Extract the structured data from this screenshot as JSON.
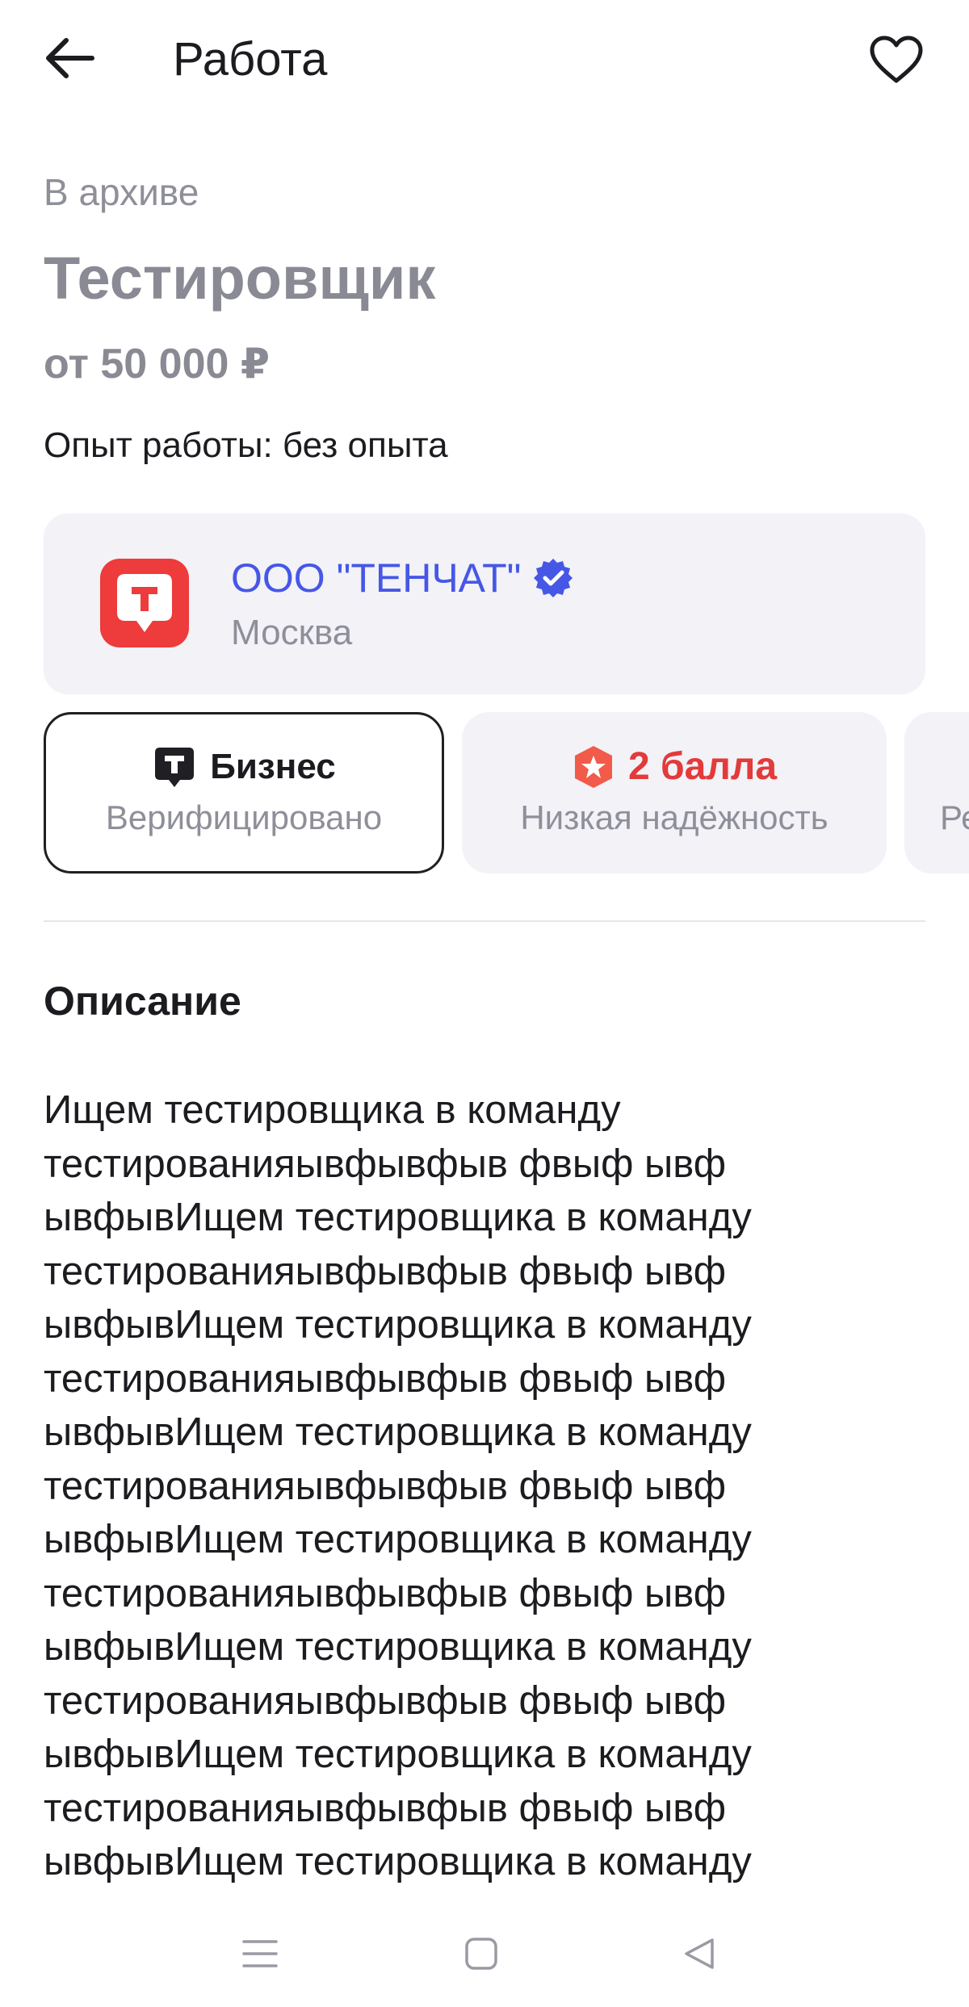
{
  "header": {
    "title": "Работа",
    "back_icon": "arrow-left-icon",
    "favorite_icon": "heart-outline-icon"
  },
  "vacancy": {
    "status": "В архиве",
    "title": "Тестировщик",
    "salary": "от 50 000 ₽",
    "experience": "Опыт работы: без опыта"
  },
  "company": {
    "name": "ООО \"ТЕНЧАТ\"",
    "city": "Москва",
    "verified_icon": "verified-badge-icon",
    "logo_letter": "T",
    "brand_color": "#EE3B3B",
    "link_color": "#4657E6"
  },
  "badges": [
    {
      "title": "Бизнес",
      "subtitle": "Верифицировано",
      "icon": "tenchat-logo-icon"
    },
    {
      "title": "2 балла",
      "subtitle": "Низкая надёжность",
      "icon": "shield-star-icon",
      "color": "#E33A3A"
    },
    {
      "subtitle": "Ре"
    }
  ],
  "description": {
    "heading": "Описание",
    "text": "Ищем тестировщика в команду\nтестированияывфывфыв фвыф ывф\nывфывИщем тестировщика в команду\nтестированияывфывфыв фвыф ывф\nывфывИщем тестировщика в команду\nтестированияывфывфыв фвыф ывф\nывфывИщем тестировщика в команду\nтестированияывфывфыв фвыф ывф\nывфывИщем тестировщика в команду\nтестированияывфывфыв фвыф ывф\nывфывИщем тестировщика в команду\nтестированияывфывфыв фвыф ывф\nывфывИщем тестировщика в команду\nтестированияывфывфыв фвыф ывф\nывфывИщем тестировщика в команду"
  },
  "system_nav": {
    "menu_icon": "menu-lines-icon",
    "home_icon": "square-home-icon",
    "back_icon": "triangle-back-icon"
  }
}
